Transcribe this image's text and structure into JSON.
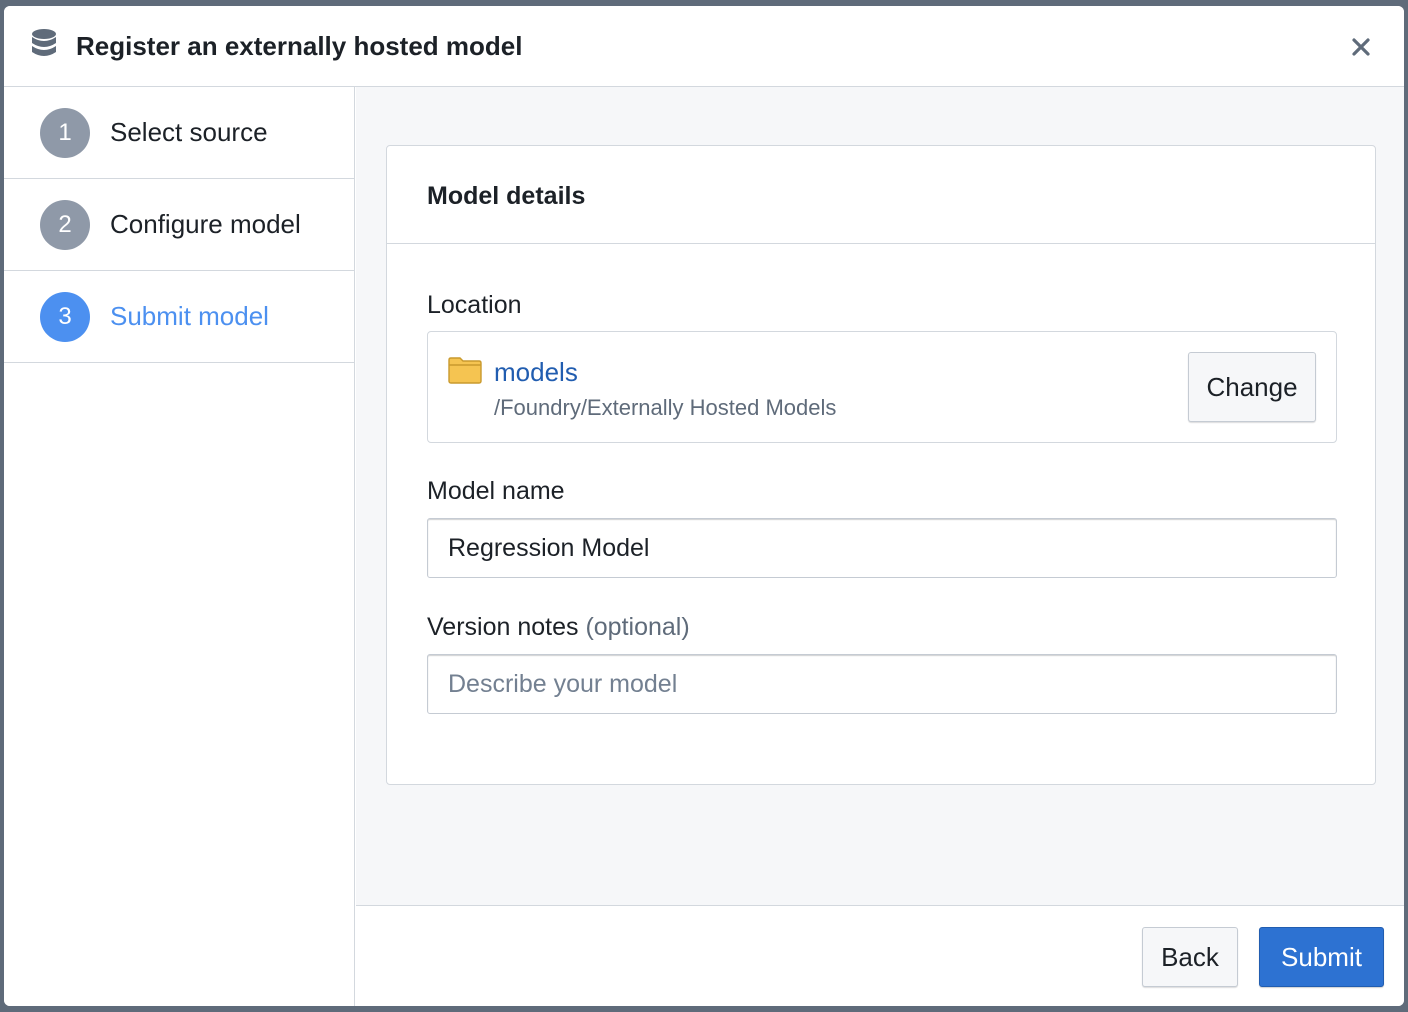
{
  "dialog": {
    "title": "Register an externally hosted model",
    "title_icon": "database-icon",
    "close_icon": "close-icon"
  },
  "steps": [
    {
      "number": "1",
      "label": "Select source",
      "active": false
    },
    {
      "number": "2",
      "label": "Configure model",
      "active": false
    },
    {
      "number": "3",
      "label": "Submit model",
      "active": true
    }
  ],
  "card": {
    "title": "Model details",
    "location": {
      "label": "Location",
      "folder_icon": "folder-icon",
      "folder_name": "models",
      "folder_path": "/Foundry/Externally Hosted Models",
      "change_label": "Change"
    },
    "model_name": {
      "label": "Model name",
      "value": "Regression Model"
    },
    "version_notes": {
      "label": "Version notes",
      "optional_label": "(optional)",
      "value": "",
      "placeholder": "Describe your model"
    }
  },
  "footer": {
    "back_label": "Back",
    "submit_label": "Submit"
  },
  "colors": {
    "active_step": "#4c90f0",
    "inactive_step": "#8f99a8",
    "primary_button": "#2d72d2",
    "link": "#215db0",
    "folder": "#f5c451"
  }
}
